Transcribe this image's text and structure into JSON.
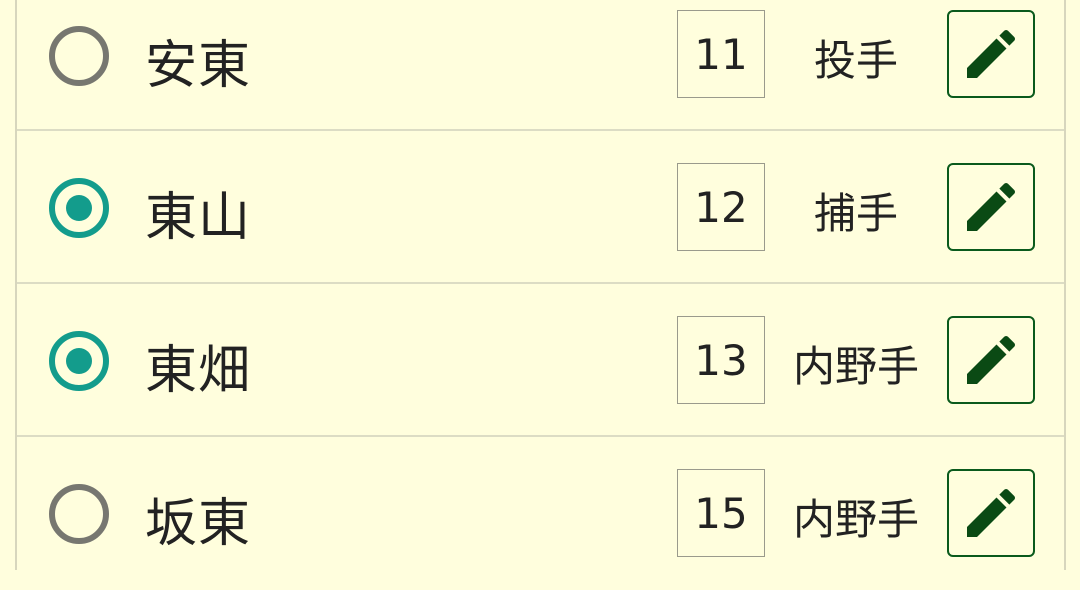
{
  "players": [
    {
      "name": "安東",
      "number": "11",
      "position": "投手",
      "selected": false
    },
    {
      "name": "東山",
      "number": "12",
      "position": "捕手",
      "selected": true
    },
    {
      "name": "東畑",
      "number": "13",
      "position": "内野手",
      "selected": true
    },
    {
      "name": "坂東",
      "number": "15",
      "position": "内野手",
      "selected": false
    }
  ],
  "icons": {
    "radio": "radio-icon",
    "edit": "pencil-icon"
  },
  "colors": {
    "background": "#fffedd",
    "accent": "#139c8c",
    "edit": "#0a5a1c"
  }
}
